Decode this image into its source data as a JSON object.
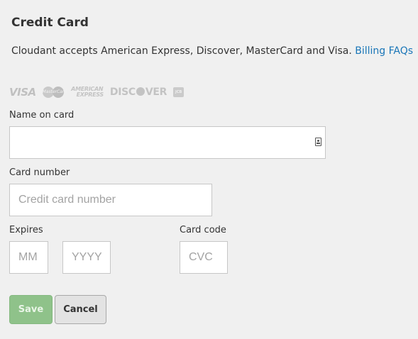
{
  "header": {
    "title": "Credit Card"
  },
  "intro": {
    "text": "Cloudant accepts American Express, Discover, MasterCard and Visa.",
    "link": "Billing FAQs"
  },
  "card_logos": {
    "visa": "VISA",
    "mastercard": "MasterCard",
    "amex_line1": "AMERICAN",
    "amex_line2": "EXPRESS",
    "discover_a": "DISC",
    "discover_b": "VER",
    "jcb": "JCB"
  },
  "form": {
    "name_label": "Name on card",
    "name_value": "",
    "number_label": "Card number",
    "number_placeholder": "Credit card number",
    "expires_label": "Expires",
    "month_placeholder": "MM",
    "year_placeholder": "YYYY",
    "code_label": "Card code",
    "code_placeholder": "CVC"
  },
  "buttons": {
    "save": "Save",
    "cancel": "Cancel"
  },
  "colors": {
    "link": "#1a76b8",
    "save_bg": "#8fc28a",
    "cancel_bg": "#e3e3e3",
    "background": "#f0f0f0"
  }
}
